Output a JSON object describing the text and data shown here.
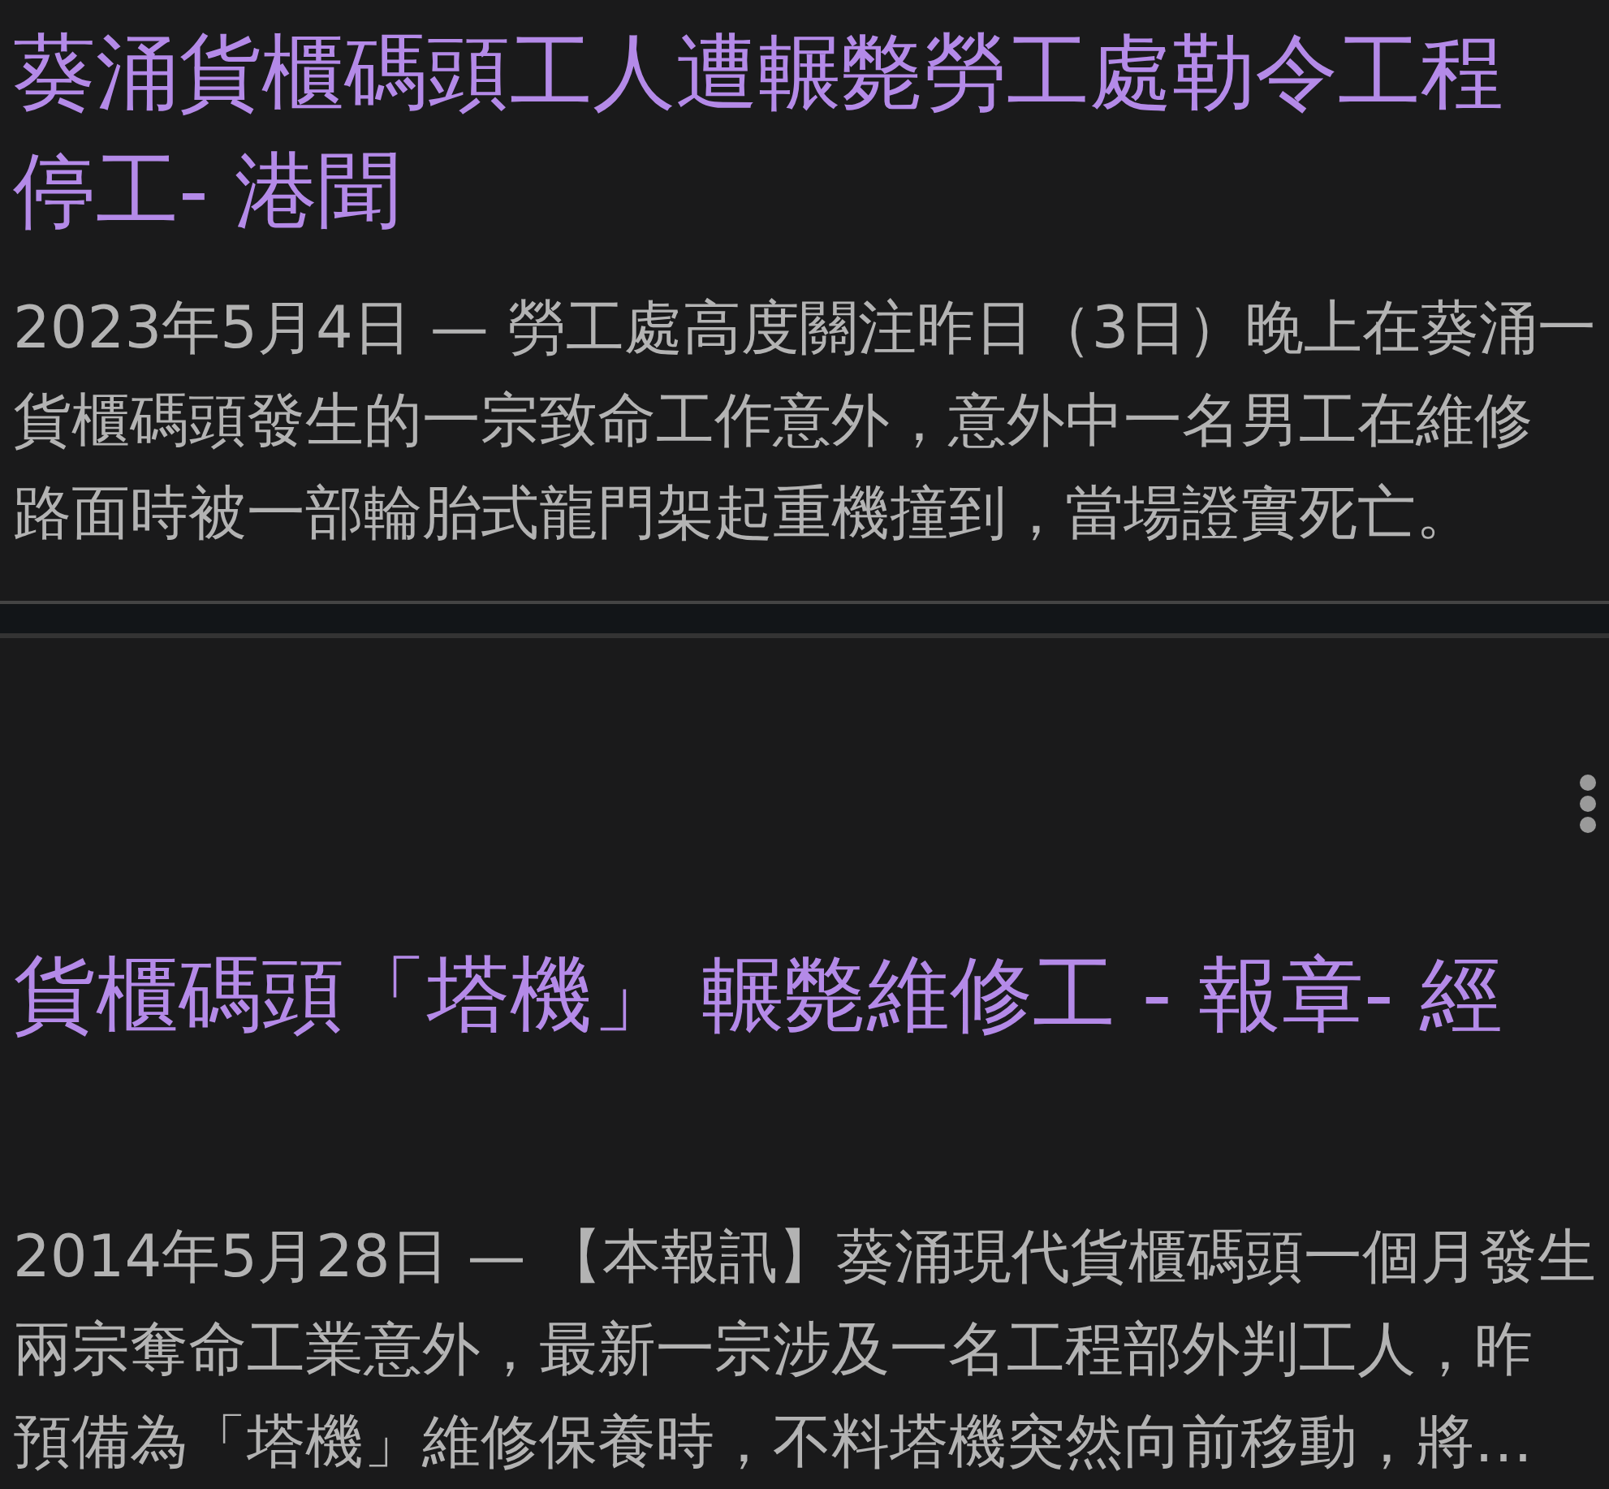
{
  "results": [
    {
      "title": [
        "葵涌貨櫃碼頭工人遭輾斃勞工處勒令工程",
        "停工- 港聞"
      ],
      "snippet": [
        "2023年5月4日 — 勞工處高度關注昨日（3日）晚上在葵涌一",
        "貨櫃碼頭發生的一宗致命工作意外，意外中一名男工在維修",
        "路面時被一部輪胎式龍門架起重機撞到，當場證實死亡。"
      ],
      "more_menu": false
    },
    {
      "title": [
        "貨櫃碼頭「塔機」 輾斃維修工 - 報章- 經"
      ],
      "snippet": [
        "2014年5月28日 — 【本報訊】葵涌現代貨櫃碼頭一個月發生",
        "兩宗奪命工業意外，最新一宗涉及一名工程部外判工人，昨",
        "預備為「塔機」維修保養時，不料塔機突然向前移動，將…"
      ],
      "more_menu": true
    }
  ]
}
